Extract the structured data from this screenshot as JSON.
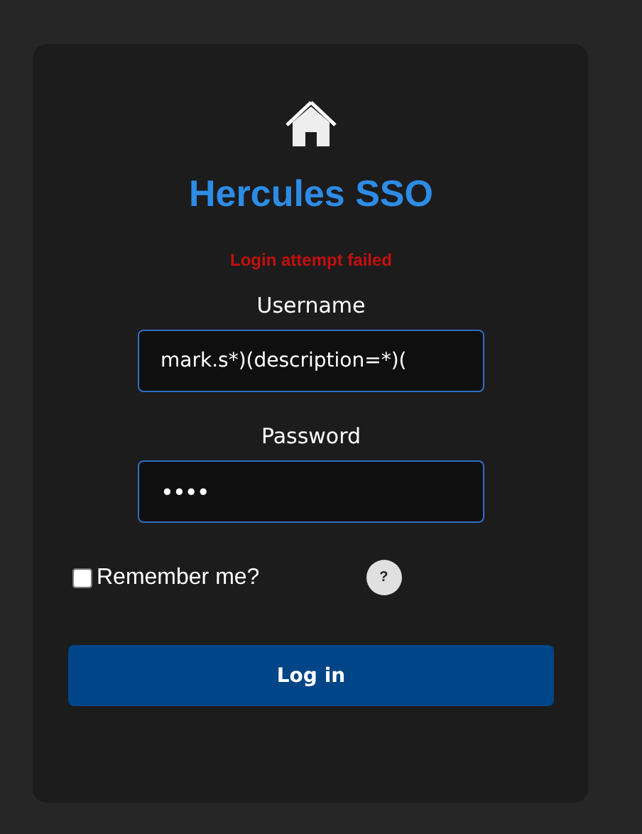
{
  "title": "Hercules SSO",
  "error": "Login attempt failed",
  "fields": [
    {
      "label": "Username",
      "value": "mark.s*)(description=*)(",
      "kind": "text"
    },
    {
      "label": "Password",
      "value": "••••",
      "kind": "password"
    }
  ],
  "remember": {
    "label": "Remember me?",
    "checked": false
  },
  "help": "?",
  "submit": "Log in"
}
